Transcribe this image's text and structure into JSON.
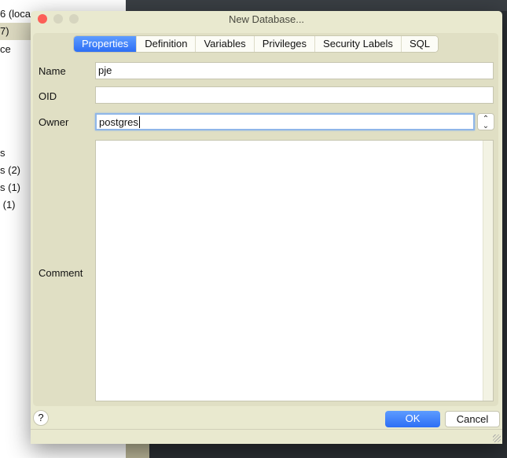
{
  "background": {
    "tree_fragments": [
      "6 (loca",
      "7)",
      "ce",
      "s",
      "s (2)",
      "s (1)",
      " (1)"
    ]
  },
  "dialog": {
    "title": "New Database...",
    "tabs": [
      {
        "label": "Properties",
        "active": true
      },
      {
        "label": "Definition"
      },
      {
        "label": "Variables"
      },
      {
        "label": "Privileges"
      },
      {
        "label": "Security Labels"
      },
      {
        "label": "SQL"
      }
    ],
    "fields": {
      "name_label": "Name",
      "name_value": "pje",
      "oid_label": "OID",
      "oid_value": "",
      "owner_label": "Owner",
      "owner_value": "postgres",
      "comment_label": "Comment",
      "comment_value": ""
    },
    "help_label": "?",
    "ok_label": "OK",
    "cancel_label": "Cancel"
  },
  "colors": {
    "accent": "#2d6ef5",
    "dialog_bg": "#e9e9cf",
    "close": "#fc5f57"
  }
}
